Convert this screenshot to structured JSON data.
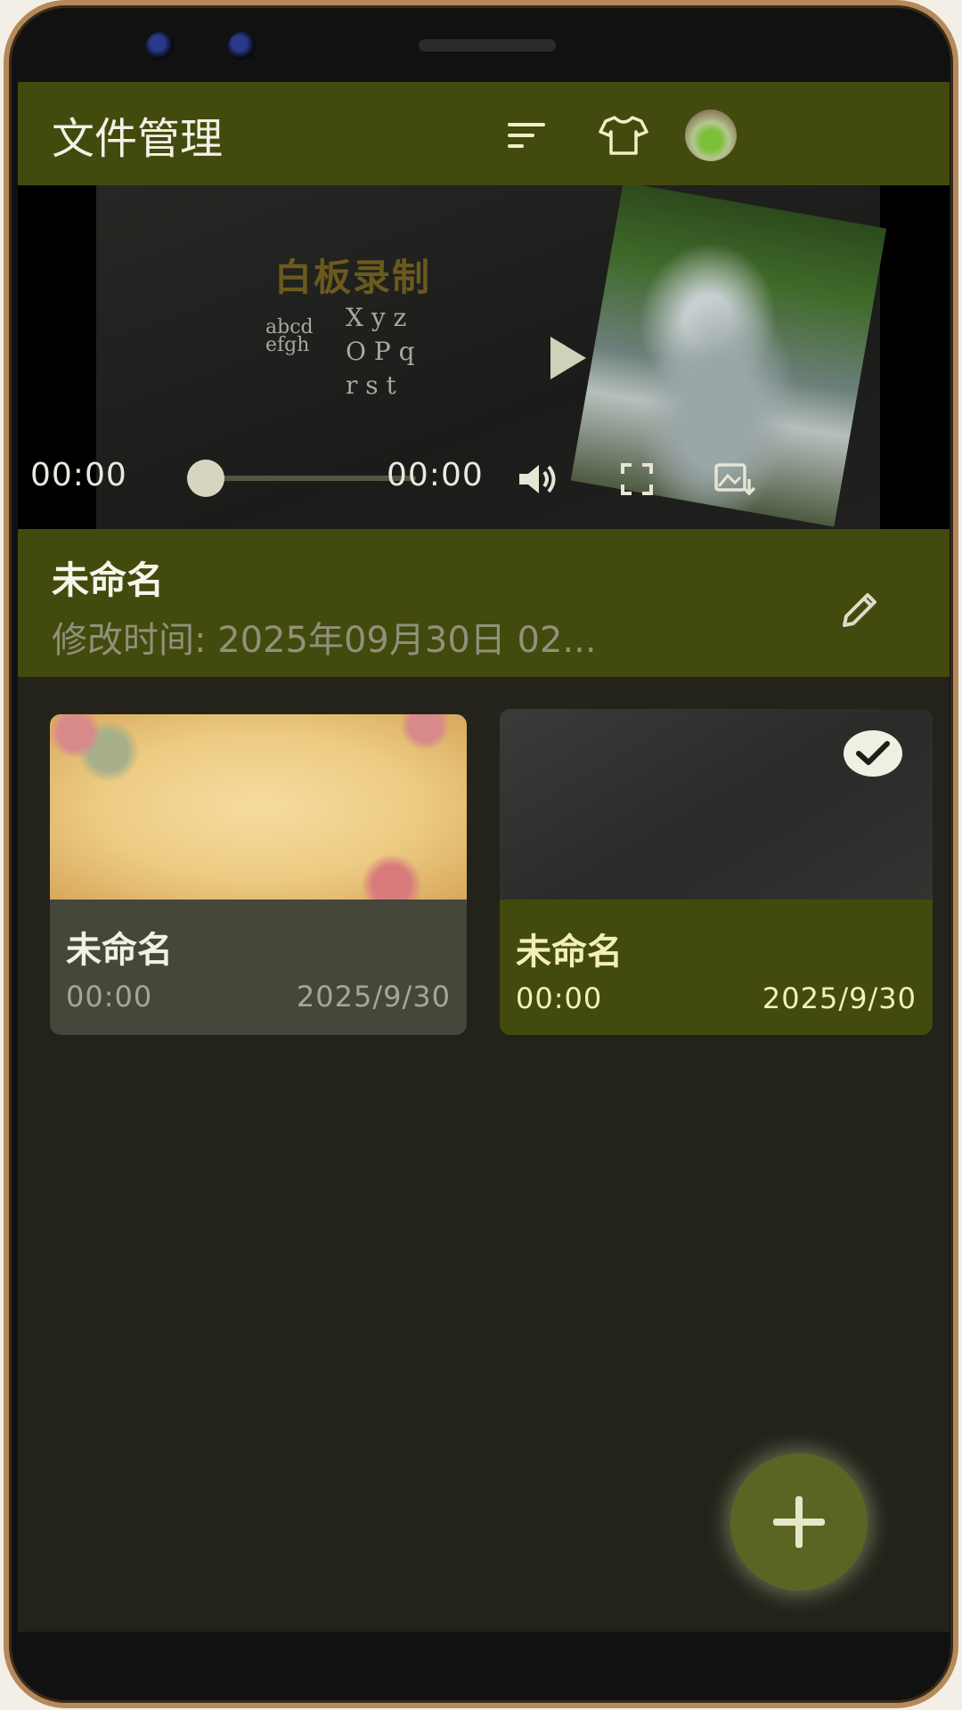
{
  "app": {
    "title": "文件管理",
    "colors": {
      "primary": "#434a0d",
      "background": "#23231b",
      "fab": "#5b6523"
    }
  },
  "appbar_icons": [
    "sort-icon",
    "shirt-icon",
    "avatar"
  ],
  "player": {
    "board_title": "白板录制",
    "chalk_lines": [
      "abcd",
      "efgh",
      "X y z",
      "O P q",
      "r s t"
    ],
    "current_time": "00:00",
    "total_time": "00:00",
    "progress": 0
  },
  "selected": {
    "name": "未命名",
    "modified": "修改时间:  2025年09月30日 02..."
  },
  "cards": [
    {
      "name": "未命名",
      "duration": "00:00",
      "date": "2025/9/30",
      "selected": false
    },
    {
      "name": "未命名",
      "duration": "00:00",
      "date": "2025/9/30",
      "selected": true
    }
  ]
}
